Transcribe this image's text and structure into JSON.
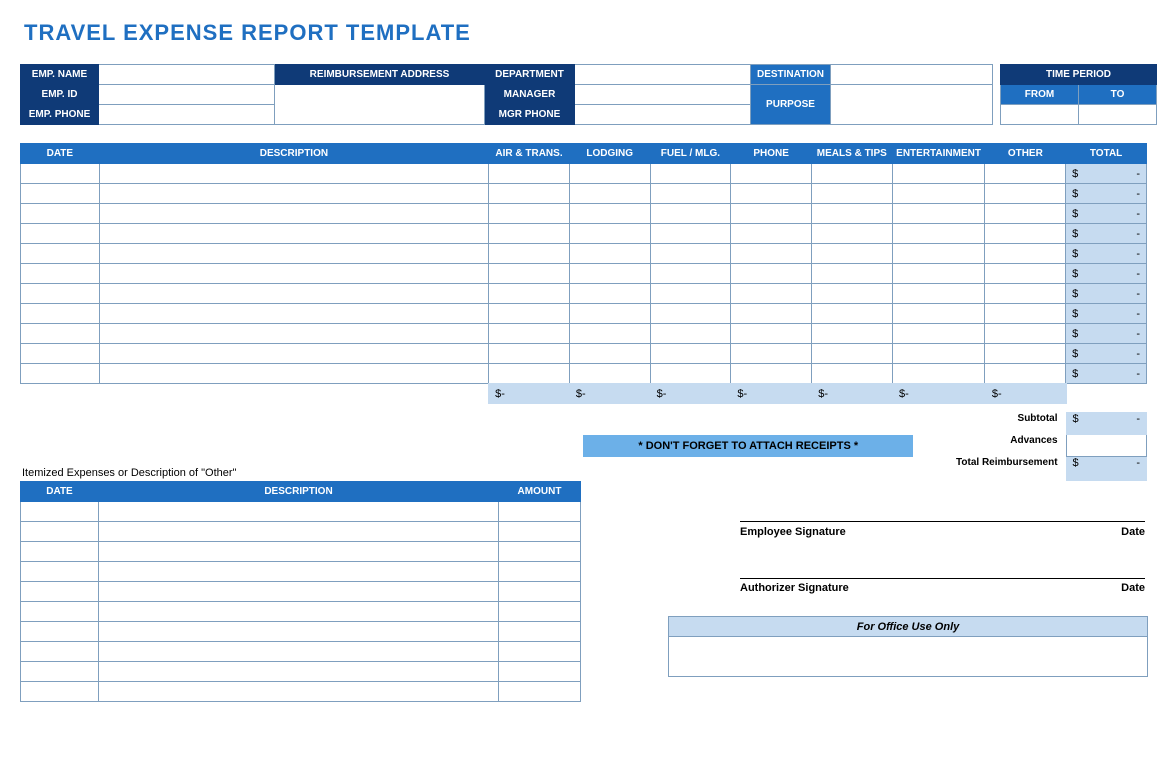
{
  "title": "TRAVEL EXPENSE REPORT TEMPLATE",
  "header": {
    "emp_name": "EMP. NAME",
    "emp_id": "EMP. ID",
    "emp_phone": "EMP. PHONE",
    "reimb_addr": "REIMBURSEMENT ADDRESS",
    "department": "DEPARTMENT",
    "manager": "MANAGER",
    "mgr_phone": "MGR PHONE",
    "destination": "DESTINATION",
    "purpose": "PURPOSE",
    "time_period": "TIME PERIOD",
    "from": "FROM",
    "to": "TO"
  },
  "cols": {
    "date": "DATE",
    "desc": "DESCRIPTION",
    "air": "AIR & TRANS.",
    "lodging": "LODGING",
    "fuel": "FUEL / MLG.",
    "phone": "PHONE",
    "meals": "MEALS & TIPS",
    "ent": "ENTERTAINMENT",
    "other": "OTHER",
    "total": "TOTAL"
  },
  "money": {
    "sym": "$",
    "dash": "-"
  },
  "main_rows": 11,
  "summary": {
    "subtotal": "Subtotal",
    "advances": "Advances",
    "total_reimb": "Total Reimbursement"
  },
  "note": "* DON'T FORGET TO ATTACH RECEIPTS *",
  "itemized": {
    "title": "Itemized Expenses or Description of \"Other\"",
    "date": "DATE",
    "desc": "DESCRIPTION",
    "amount": "AMOUNT",
    "rows": 10
  },
  "sign": {
    "emp": "Employee Signature",
    "auth": "Authorizer Signature",
    "date": "Date"
  },
  "office": "For Office Use Only"
}
